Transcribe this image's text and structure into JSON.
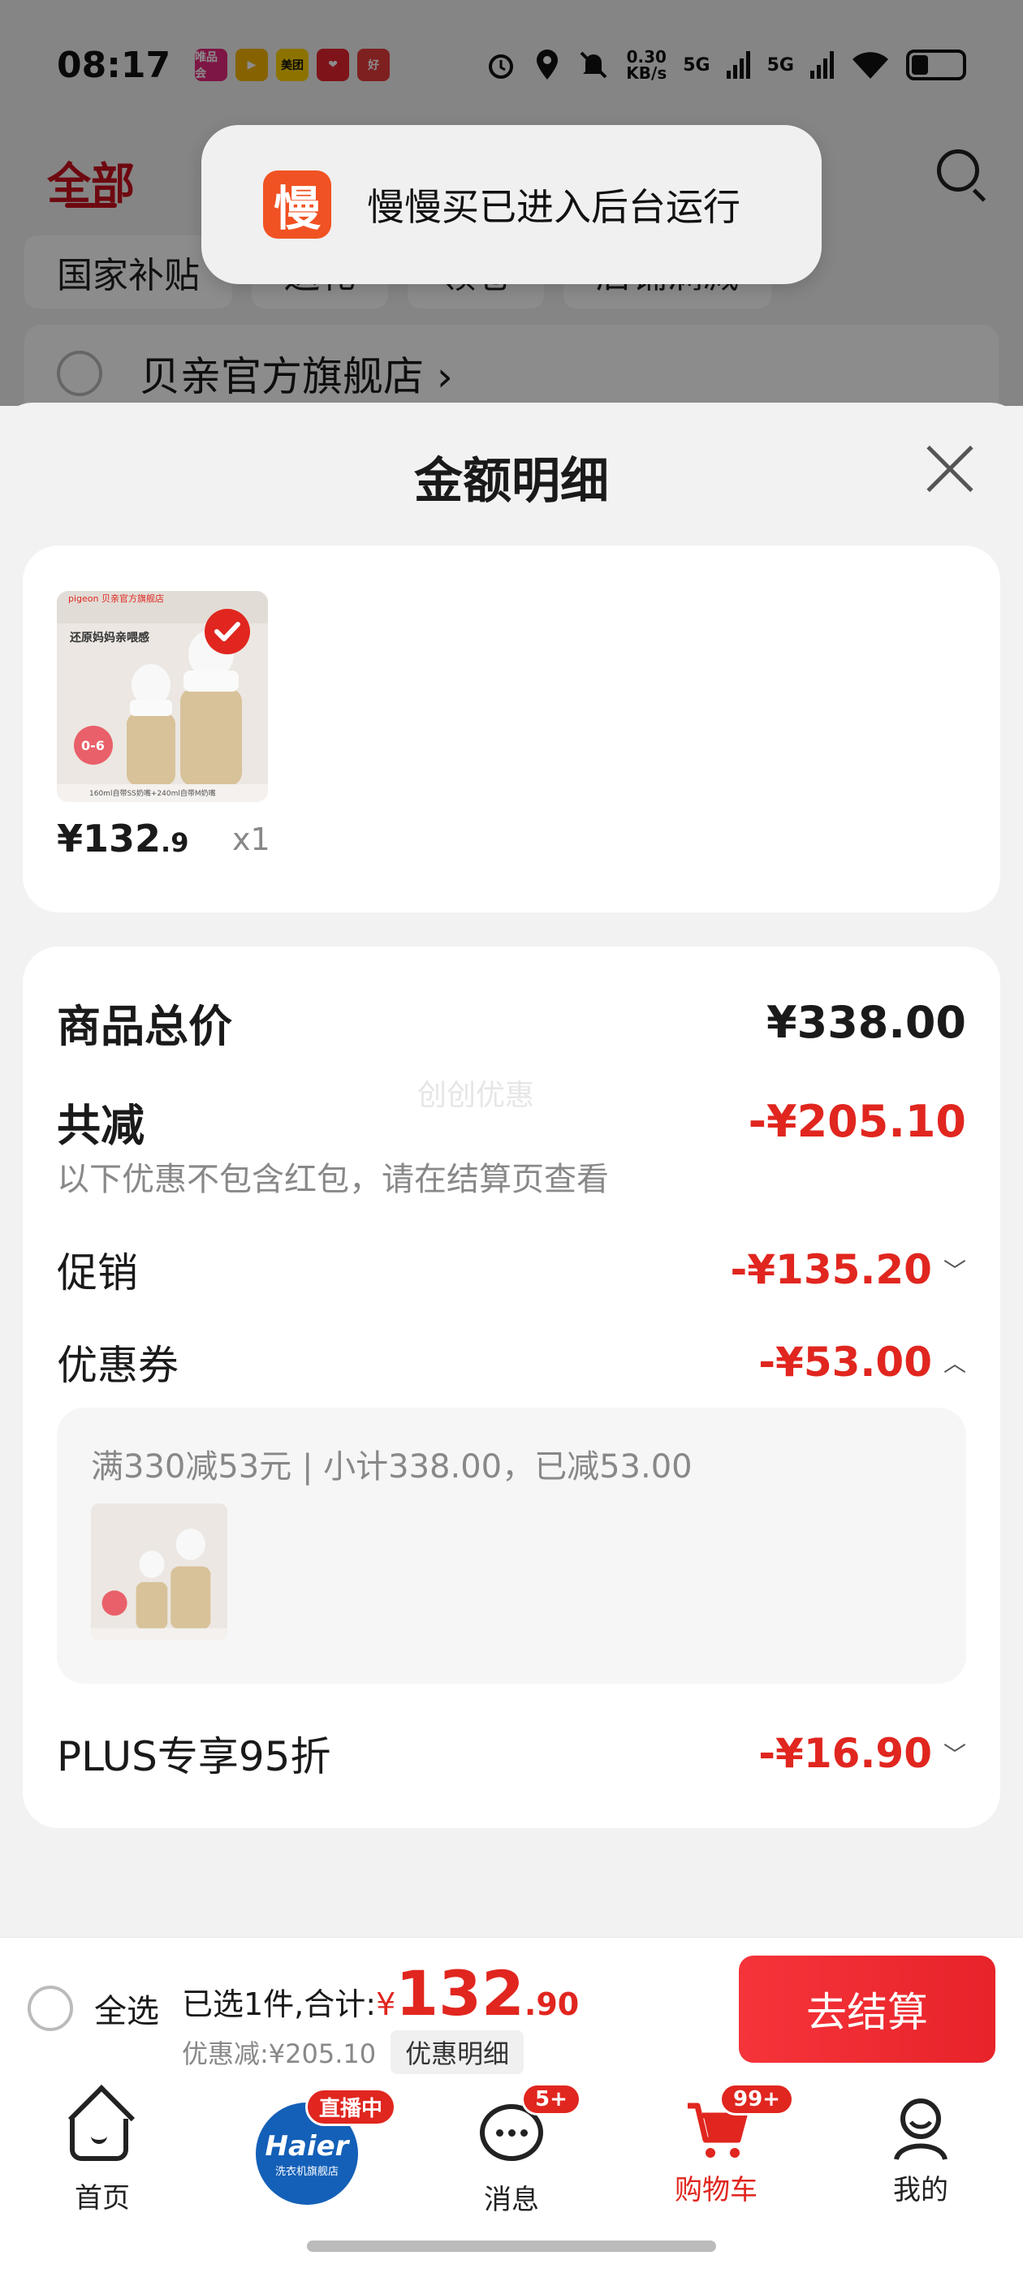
{
  "status_bar": {
    "time": "08:17",
    "apps": [
      "唯品会",
      "▶",
      "美团",
      "❤",
      "好"
    ],
    "net_speed": "0.30\nKB/s",
    "signal_1": "5G",
    "signal_2": "5G"
  },
  "background": {
    "tab_all": "全部",
    "chips": [
      "国家补贴",
      "送礼",
      "领卷",
      "店铺满减"
    ],
    "shop_name": "贝亲官方旗舰店 ›"
  },
  "toast": {
    "logo_char": "慢",
    "text": "慢慢买已进入后台运行"
  },
  "sheet": {
    "title": "金额明细",
    "product": {
      "price_int": "¥132",
      "price_dec": ".9",
      "quantity": "x1",
      "thumb_text": "还原妈妈亲喂感",
      "brand": "pigeon 贝亲官方旗舰店",
      "caption": "160ml自带SS奶嘴+240ml自带M奶嘴",
      "age": "0-6"
    },
    "total_label": "商品总价",
    "total_value": "¥338.00",
    "discount_label": "共减",
    "discount_value": "-¥205.10",
    "discount_note": "以下优惠不包含红包，请在结算页查看",
    "watermark": "创创优惠",
    "promo_label": "促销",
    "promo_value": "-¥135.20",
    "coupon_label": "优惠券",
    "coupon_value": "-¥53.00",
    "coupon_detail": "满330减53元 | 小计338.00，已减53.00",
    "plus_label": "PLUS专享95折",
    "plus_value": "-¥16.90"
  },
  "action_bar": {
    "select_all": "全选",
    "selected_text": "已选1件,合计:",
    "currency": "¥",
    "total_int": "132",
    "total_dec": ".90",
    "discount_text": "优惠减:¥205.10",
    "detail_button": "优惠明细",
    "checkout_button": "去结算"
  },
  "tab_bar": {
    "home": "首页",
    "live_badge": "直播中",
    "live_brand": "Haier",
    "live_sub": "洗衣机旗舰店",
    "messages": "消息",
    "messages_badge": "5+",
    "cart": "购物车",
    "cart_badge": "99+",
    "me": "我的"
  },
  "colors": {
    "accent_red": "#e0261f",
    "toast_logo": "#f05223"
  }
}
